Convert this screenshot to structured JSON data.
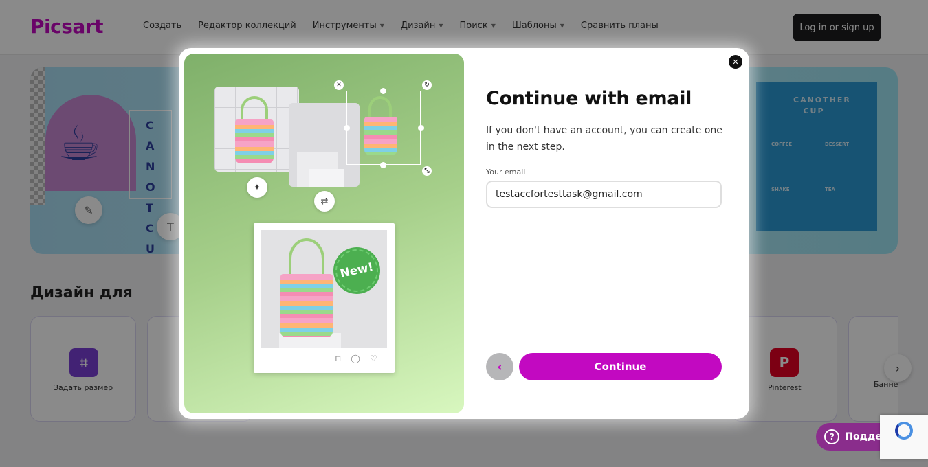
{
  "header": {
    "logo": "Picsart",
    "nav": [
      {
        "label": "Создать",
        "dropdown": false
      },
      {
        "label": "Редактор коллекций",
        "dropdown": false
      },
      {
        "label": "Инструменты",
        "dropdown": true
      },
      {
        "label": "Дизайн",
        "dropdown": true
      },
      {
        "label": "Поиск",
        "dropdown": true
      },
      {
        "label": "Шаблоны",
        "dropdown": true
      },
      {
        "label": "Сравнить планы",
        "dropdown": false
      }
    ],
    "login_label": "Log in or sign up"
  },
  "hero": {
    "vertical_text": "CANOT CU",
    "menu_title": "CANOTHER CUP",
    "menu_columns": [
      "COFFEE",
      "DESSERT",
      "SHAKE",
      "TEA"
    ]
  },
  "design_section": {
    "title": "Дизайн для",
    "cards": [
      {
        "label": "Задать размер",
        "icon": "crop-icon",
        "color": "#7b3fd6"
      },
      {
        "label": "Pinterest",
        "icon": "pinterest-icon",
        "color": "#e60023"
      },
      {
        "label": "Банне",
        "icon": "banner-icon",
        "color": "#ffffff"
      }
    ]
  },
  "support": {
    "label": "Поддержка"
  },
  "modal": {
    "title": "Continue with email",
    "description": "If you don't have an account, you can create one in the next step.",
    "email_label": "Your email",
    "email_value": "testaccfortesttask@gmail.com",
    "continue_label": "Continue",
    "badge_text": "New!"
  },
  "colors": {
    "brand": "#c209c1",
    "overlay": "rgba(0,0,0,0.46)",
    "illustration_green": "#a6cf8a"
  }
}
